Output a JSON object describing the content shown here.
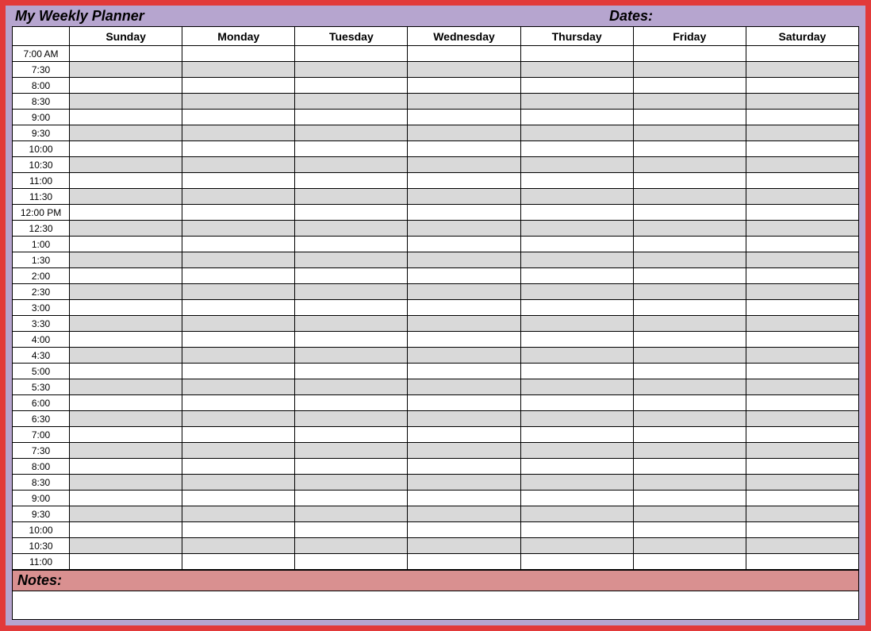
{
  "header": {
    "title": "My Weekly Planner",
    "dates_label": "Dates:"
  },
  "columns": [
    "",
    "Sunday",
    "Monday",
    "Tuesday",
    "Wednesday",
    "Thursday",
    "Friday",
    "Saturday"
  ],
  "time_slots": [
    "7:00 AM",
    "7:30",
    "8:00",
    "8:30",
    "9:00",
    "9:30",
    "10:00",
    "10:30",
    "11:00",
    "11:30",
    "12:00 PM",
    "12:30",
    "1:00",
    "1:30",
    "2:00",
    "2:30",
    "3:00",
    "3:30",
    "4:00",
    "4:30",
    "5:00",
    "5:30",
    "6:00",
    "6:30",
    "7:00",
    "7:30",
    "8:00",
    "8:30",
    "9:00",
    "9:30",
    "10:00",
    "10:30",
    "11:00"
  ],
  "notes": {
    "label": "Notes:",
    "content": ""
  }
}
